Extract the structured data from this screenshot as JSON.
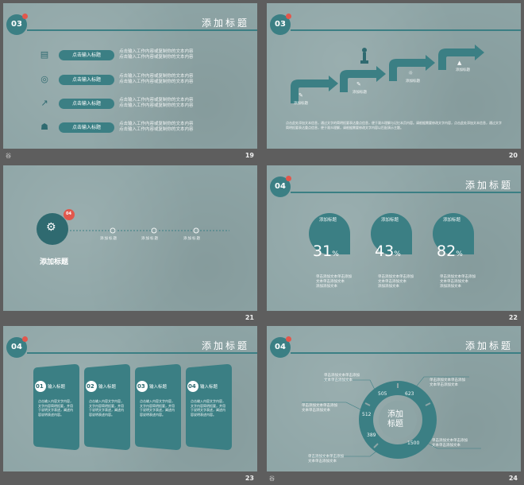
{
  "slide19": {
    "badge": "03",
    "title": "添加标题",
    "page": "19",
    "rows": [
      {
        "icon": "briefcase-icon",
        "button": "点击输入标题",
        "text1": "点击输入工作内容或复制你的文本内容",
        "text2": "点击输入工作内容或复制你的文本内容"
      },
      {
        "icon": "coin-icon",
        "button": "点击输入标题",
        "text1": "点击输入工作内容或复制你的文本内容",
        "text2": "点击输入工作内容或复制你的文本内容"
      },
      {
        "icon": "growth-chart-icon",
        "button": "点击输入标题",
        "text1": "点击输入工作内容或复制你的文本内容",
        "text2": "点击输入工作内容或复制你的文本内容"
      },
      {
        "icon": "team-icon",
        "button": "点击输入标题",
        "text1": "点击输入工作内容或复制你的文本内容",
        "text2": "点击输入工作内容或复制你的文本内容"
      }
    ]
  },
  "slide20": {
    "badge": "03",
    "page": "20",
    "steps": [
      "添加标题",
      "添加标题",
      "添加标题",
      "添加标题"
    ],
    "paragraph": "点击此处添加文本信息，通过文字的简明扼要表达重点信息，便于观众理解与记忆本页内容。请根据需要修改文字内容，点击此处添加文本信息，通过文字简明扼要表达重点信息，便于观众理解，请根据需要修改文字内容以匹配演示主题。"
  },
  "slide21": {
    "badge": "04",
    "page": "21",
    "heading": "添加标题",
    "points": [
      "添加标题",
      "添加标题",
      "添加标题"
    ]
  },
  "slide22": {
    "badge": "04",
    "title": "添加标题",
    "page": "22",
    "items": [
      {
        "label": "添加标题",
        "value": "31",
        "unit": "%",
        "desc1": "单击添加文本单击添加",
        "desc2": "文本单击添加文本",
        "desc3": "添加添加文本"
      },
      {
        "label": "添加标题",
        "value": "43",
        "unit": "%",
        "desc1": "单击添加文本单击添加",
        "desc2": "文本单击添加文本",
        "desc3": "添加添加文本"
      },
      {
        "label": "添加标题",
        "value": "82",
        "unit": "%",
        "desc1": "单击添加文本单击添加",
        "desc2": "文本单击添加文本",
        "desc3": "添加添加文本"
      }
    ]
  },
  "slide23": {
    "badge": "04",
    "title": "添加标题",
    "page": "23",
    "cards": [
      {
        "num": "01",
        "title": "输入标题",
        "body": "点击输入内容文字内容，文字内容简明扼要，并用于说明文字表述，阐述内容说明表述内容。"
      },
      {
        "num": "02",
        "title": "输入标题",
        "body": "点击输入内容文字内容，文字内容简明扼要，并用于说明文字表述，阐述内容说明表述内容。"
      },
      {
        "num": "03",
        "title": "输入标题",
        "body": "点击输入内容文字内容，文字内容简明扼要，并用于说明文字表述，阐述内容说明表述内容。"
      },
      {
        "num": "04",
        "title": "输入标题",
        "body": "点击输入内容文字内容，文字内容简明扼要，并用于说明文字表述，阐述内容说明表述内容。"
      }
    ]
  },
  "slide24": {
    "badge": "04",
    "title": "添加标题",
    "page": "24",
    "center1": "添加",
    "center2": "标题",
    "values": [
      "505",
      "623",
      "512",
      "389",
      "1500"
    ],
    "notes": [
      {
        "l1": "单击添加文本单击添加",
        "l2": "文本单击添加文本"
      },
      {
        "l1": "单击添加文本单击添加",
        "l2": "文本单击添加文本"
      },
      {
        "l1": "单击添加文本单击添加",
        "l2": "文本单击添加文本"
      },
      {
        "l1": "单击添加文本单击添加",
        "l2": "文本单击添加文本"
      },
      {
        "l1": "单击添加文本单击添加",
        "l2": "文本单击添加文本"
      }
    ]
  },
  "footer_glyph": "谷",
  "colors": {
    "teal": "#3b7f84",
    "slide_bg": "#8ea5a6",
    "accent_red": "#e2574c",
    "page_bg": "#5e5e5e"
  }
}
